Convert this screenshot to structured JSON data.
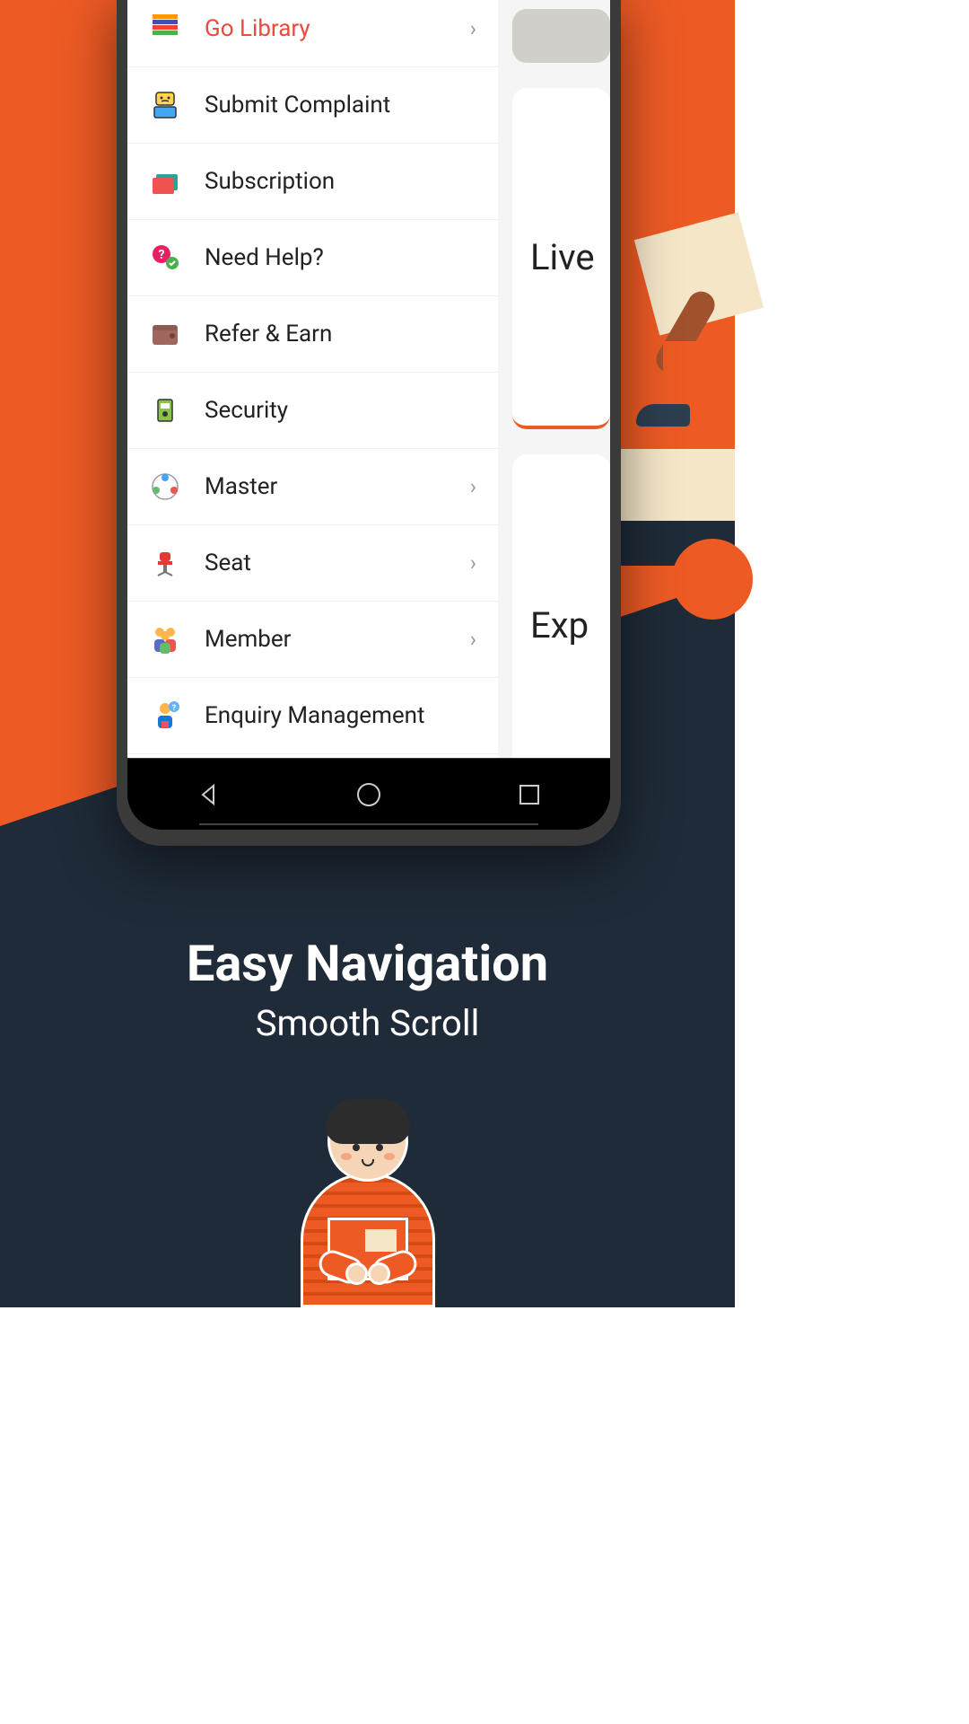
{
  "menu": {
    "items": [
      {
        "label": "Go Library",
        "active": true,
        "has_chevron": true,
        "icon": "books"
      },
      {
        "label": "Submit Complaint",
        "active": false,
        "has_chevron": false,
        "icon": "complaint"
      },
      {
        "label": "Subscription",
        "active": false,
        "has_chevron": false,
        "icon": "folder"
      },
      {
        "label": "Need Help?",
        "active": false,
        "has_chevron": false,
        "icon": "help"
      },
      {
        "label": "Refer & Earn",
        "active": false,
        "has_chevron": false,
        "icon": "wallet"
      },
      {
        "label": "Security",
        "active": false,
        "has_chevron": false,
        "icon": "security"
      },
      {
        "label": "Master",
        "active": false,
        "has_chevron": true,
        "icon": "master"
      },
      {
        "label": "Seat",
        "active": false,
        "has_chevron": true,
        "icon": "seat"
      },
      {
        "label": "Member",
        "active": false,
        "has_chevron": true,
        "icon": "member"
      },
      {
        "label": "Enquiry Management",
        "active": false,
        "has_chevron": false,
        "icon": "enquiry"
      }
    ]
  },
  "cards": {
    "live": "Live",
    "exp": "Exp"
  },
  "promo": {
    "title": "Easy Navigation",
    "subtitle": "Smooth Scroll"
  },
  "colors": {
    "accent": "#ed5a24",
    "dark": "#1f2b38",
    "active_text": "#e74c3c"
  }
}
